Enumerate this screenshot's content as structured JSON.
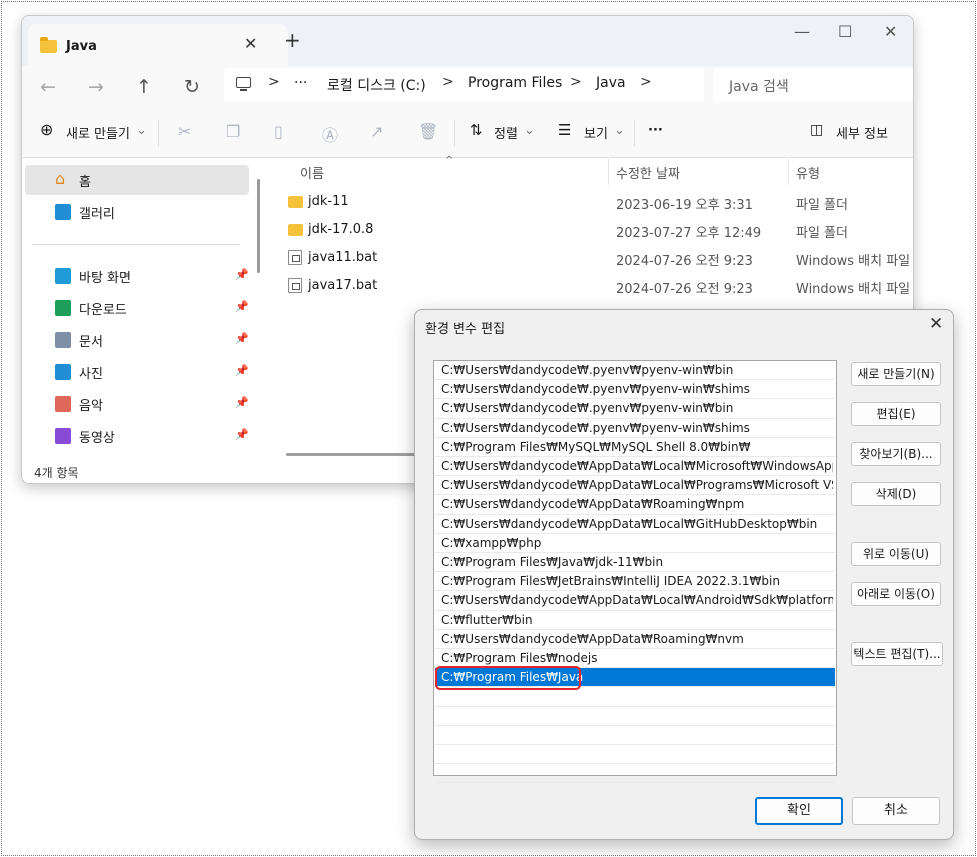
{
  "explorer": {
    "tab_title": "Java",
    "tab_close": "✕",
    "tab_add": "+",
    "window_controls": {
      "minimize": "—",
      "maximize": "☐",
      "close": "✕"
    },
    "nav": {
      "back": "←",
      "forward": "→",
      "up": "↑",
      "refresh": "↻"
    },
    "breadcrumb": {
      "more": "···",
      "items": [
        "로컬 디스크 (C:)",
        "Program Files",
        "Java"
      ],
      "separator": ">"
    },
    "search_placeholder": "Java 검색",
    "commands": {
      "new": "새로 만들기",
      "sort": "정렬",
      "view": "보기",
      "more": "···",
      "details": "세부 정보"
    },
    "sidebar": {
      "home": "홈",
      "gallery": "갤러리",
      "pinned": [
        {
          "label": "바탕 화면",
          "icon": "desktop-icon",
          "color": "#1f9bd7"
        },
        {
          "label": "다운로드",
          "icon": "download-icon",
          "color": "#1b9e5a"
        },
        {
          "label": "문서",
          "icon": "document-icon",
          "color": "#7f8fa6"
        },
        {
          "label": "사진",
          "icon": "picture-icon",
          "color": "#1f8ed7"
        },
        {
          "label": "음악",
          "icon": "music-icon",
          "color": "#e0685a"
        },
        {
          "label": "동영상",
          "icon": "video-icon",
          "color": "#8a4ad8"
        }
      ]
    },
    "columns": {
      "name": "이름",
      "date": "수정한 날짜",
      "type": "유형"
    },
    "files": [
      {
        "name": "jdk-11",
        "date": "2023-06-19 오후 3:31",
        "type": "파일 폴더",
        "kind": "folder"
      },
      {
        "name": "jdk-17.0.8",
        "date": "2023-07-27 오후 12:49",
        "type": "파일 폴더",
        "kind": "folder"
      },
      {
        "name": "java11.bat",
        "date": "2024-07-26 오전 9:23",
        "type": "Windows 배치 파일",
        "kind": "bat"
      },
      {
        "name": "java17.bat",
        "date": "2024-07-26 오전 9:23",
        "type": "Windows 배치 파일",
        "kind": "bat"
      }
    ],
    "status": "4개 항목"
  },
  "dialog": {
    "title": "환경 변수 편집",
    "close": "✕",
    "paths": [
      "C:₩Users₩dandycode₩.pyenv₩pyenv-win₩bin",
      "C:₩Users₩dandycode₩.pyenv₩pyenv-win₩shims",
      "C:₩Users₩dandycode₩.pyenv₩pyenv-win₩bin",
      "C:₩Users₩dandycode₩.pyenv₩pyenv-win₩shims",
      "C:₩Program Files₩MySQL₩MySQL Shell 8.0₩bin₩",
      "C:₩Users₩dandycode₩AppData₩Local₩Microsoft₩WindowsApps",
      "C:₩Users₩dandycode₩AppData₩Local₩Programs₩Microsoft VS Code...",
      "C:₩Users₩dandycode₩AppData₩Roaming₩npm",
      "C:₩Users₩dandycode₩AppData₩Local₩GitHubDesktop₩bin",
      "C:₩xampp₩php",
      "C:₩Program Files₩Java₩jdk-11₩bin",
      "C:₩Program Files₩JetBrains₩IntelliJ IDEA 2022.3.1₩bin",
      "C:₩Users₩dandycode₩AppData₩Local₩Android₩Sdk₩platform-tools",
      "C:₩flutter₩bin",
      "C:₩Users₩dandycode₩AppData₩Roaming₩nvm",
      "C:₩Program Files₩nodejs",
      "C:₩Program Files₩Java",
      "",
      "",
      "",
      "",
      ""
    ],
    "selected_index": 16,
    "buttons": {
      "new": "새로 만들기(N)",
      "edit": "편집(E)",
      "browse": "찾아보기(B)...",
      "delete": "삭제(D)",
      "move_up": "위로 이동(U)",
      "move_down": "아래로 이동(O)",
      "edit_text": "텍스트 편집(T)...",
      "ok": "확인",
      "cancel": "취소"
    },
    "selection_color": "#0078d7",
    "highlight_color": "#e3242b"
  }
}
